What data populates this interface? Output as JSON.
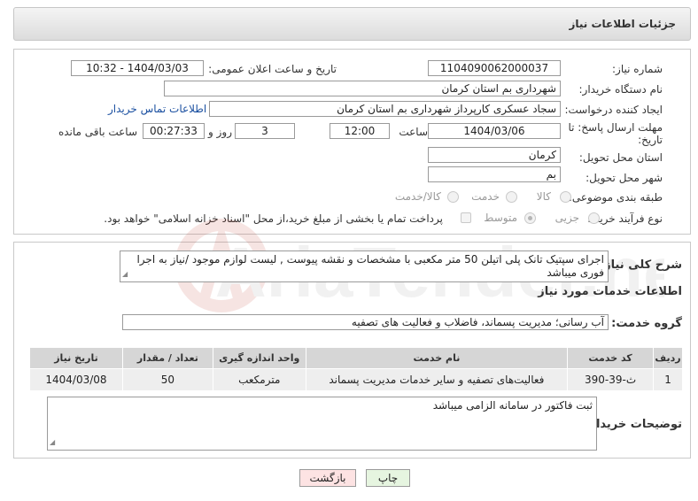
{
  "header": {
    "title": "جزئیات اطلاعات نیاز"
  },
  "form": {
    "need_number_label": "شماره نیاز:",
    "need_number": "1104090062000037",
    "announce_label": "تاریخ و ساعت اعلان عمومی:",
    "announce_value": "1404/03/03 - 10:32",
    "buyer_org_label": "نام دستگاه خریدار:",
    "buyer_org": "شهرداری بم استان کرمان",
    "requester_label": "ایجاد کننده درخواست:",
    "requester": "سجاد عسکری کارپرداز شهرداری بم استان کرمان",
    "contact_link": "اطلاعات تماس خریدار",
    "deadline_label_1": "مهلت ارسال پاسخ: تا",
    "deadline_label_2": "تاریخ:",
    "deadline_date": "1404/03/06",
    "time_label": "ساعت",
    "deadline_time": "12:00",
    "days_value": "3",
    "days_label": "روز و",
    "remaining_time": "00:27:33",
    "remaining_label": "ساعت باقی مانده",
    "province_label": "استان محل تحویل:",
    "province": "کرمان",
    "city_label": "شهر محل تحویل:",
    "city": "بم",
    "category_label": "طبقه بندی موضوعی:",
    "category_options": [
      "کالا",
      "خدمت",
      "کالا/خدمت"
    ],
    "process_label": "نوع فرآیند خرید :",
    "process_options": [
      "جزیی",
      "متوسط"
    ],
    "payment_note": "پرداخت تمام یا بخشی از مبلغ خرید،از محل \"اسناد خزانه اسلامی\" خواهد بود."
  },
  "description": {
    "label": "شرح کلی نیاز:",
    "text": "اجرای سپتیک تانک پلی اتیلن 50 متر مکعبی با مشخصات و نقشه پیوست , لیست لوازم موجود /نیاز به اجرا فوری میباشد"
  },
  "services": {
    "section_title": "اطلاعات خدمات مورد نیاز",
    "group_label": "گروه خدمت:",
    "group_value": "آب رسانی؛ مدیریت پسماند، فاضلاب و فعالیت های تصفیه",
    "columns": [
      "ردیف",
      "کد خدمت",
      "نام خدمت",
      "واحد اندازه گیری",
      "تعداد / مقدار",
      "تاریخ نیاز"
    ],
    "rows": [
      {
        "row": "1",
        "code": "ث-39-390",
        "name": "فعالیت‌های تصفیه و سایر خدمات مدیریت پسماند",
        "unit": "مترمکعب",
        "qty": "50",
        "date": "1404/03/08"
      }
    ]
  },
  "buyer_notes": {
    "label": "توضیحات خریدار:",
    "text": "ثبت فاکتور در سامانه الزامی میباشد"
  },
  "actions": {
    "print": "چاپ",
    "back": "بازگشت"
  },
  "watermark": {
    "text": "AriaTender.net"
  },
  "colors": {
    "link": "#1a4fa0",
    "back_button_bg": "#fde3e3",
    "print_button_bg": "#e6f5e0",
    "table_header": "#d6d6d6"
  }
}
